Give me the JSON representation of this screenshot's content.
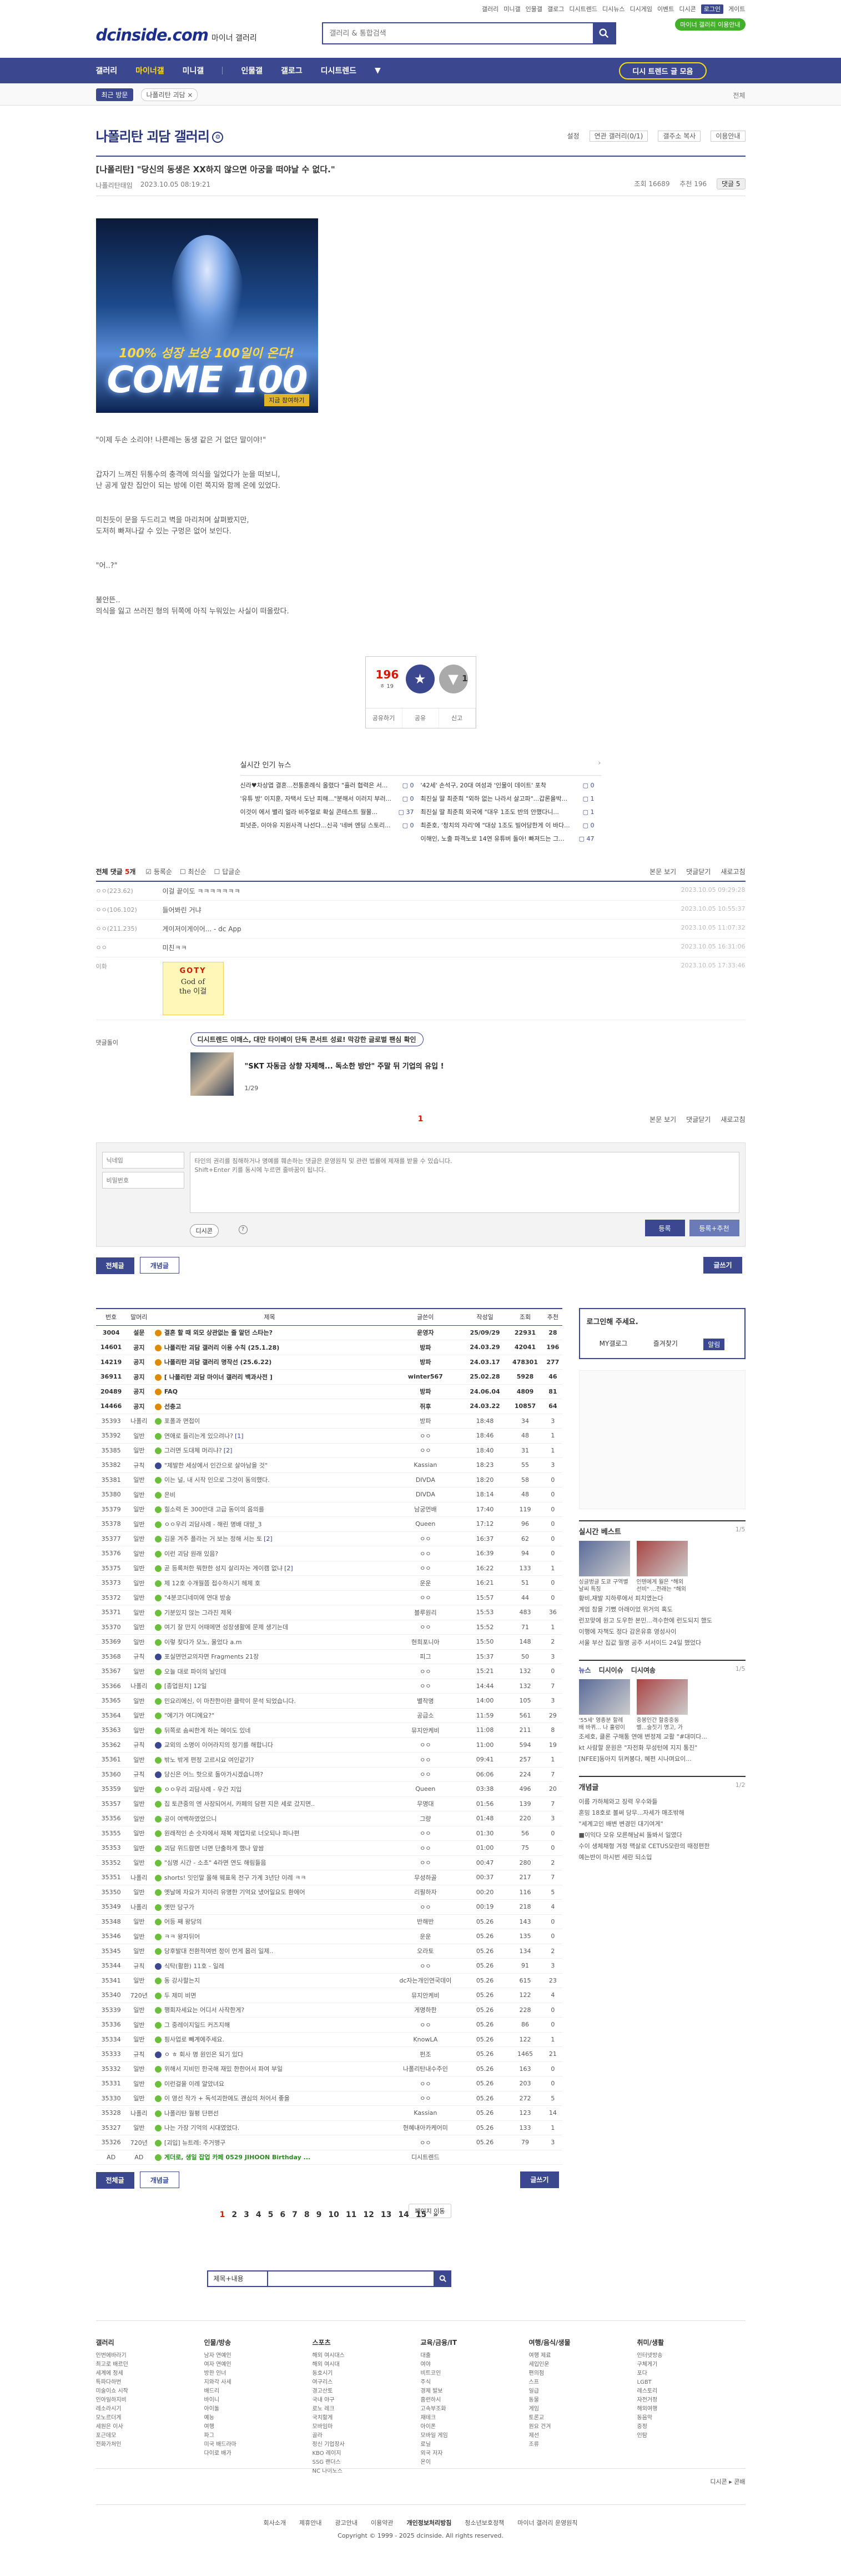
{
  "toputil": [
    "갤러리",
    "미니갤",
    "인물갤",
    "갤로그",
    "디시트렌드",
    "디시뉴스",
    "디시게임",
    "이벤트",
    "디시콘",
    "로그인",
    "게이트"
  ],
  "header": {
    "logo": "dcinside.com",
    "logo_sub": "마이너 갤러리",
    "search_placeholder": "갤러리 & 통합검색",
    "badge": "마이너 갤러리 이용안내"
  },
  "gnb": {
    "items": [
      "갤러리",
      "마이너갤",
      "미니갤",
      "인물갤",
      "갤로그",
      "디시트렌드"
    ],
    "more": "▼",
    "btn": "디시 트렌드 글 모음"
  },
  "lnb": {
    "recent": "최근 방문",
    "chip": "나폴리탄 괴담 ×",
    "all": "전체"
  },
  "gallery": {
    "title": "나폴리탄 괴담 갤러리",
    "tools": [
      "설정",
      "연관 갤러리(0/1)",
      "갤주소 복사",
      "이용안내"
    ]
  },
  "post": {
    "title": "[나폴리탄] \"당신의 동생은 XX하지 않으면 아궁을 떠야날 수 없다.\"",
    "author": "나폴리탄태임",
    "date": "2023.10.05 08:19:21",
    "views": "조회 16689",
    "rec": "추천 196",
    "cmt": "댓글 5"
  },
  "banner": {
    "l1": "100% 성장 보상 100일이 온다!",
    "l2": "COME 100",
    "l3": "지금 참여하기"
  },
  "paras": [
    "\"이제 두손 소리야! 나른레는 동생 같은 거 없단 말이야!\"",
    "갑자기 느껴진 뒤통수의 충격에 의식을 일었다가 눈을 떠보니,\n난 공게 앞찬 집안이 되는 방에 이런 쪽지와 함께 온에 있었다.",
    "미친듯이 문을 두드리고 벽을 마리처며 살펴봤지만,\n도저히 빠져나갈 수 있는 구멍은 없어 보인다.",
    "\"어..?\"",
    "불안뜬..\n의식을 잃고 쓰러진 형의 뒤쪽에 아직 누워있는 사실이 떠올랐다."
  ],
  "recommend": {
    "up": "196",
    "upsub": "ㅎ 19",
    "down": "1",
    "c1": "개념",
    "c2": "비추",
    "b": [
      "공유하기",
      "공유",
      "신고"
    ]
  },
  "news": {
    "head": "실시간 인기 뉴스",
    "left": [
      [
        "신라♥차상엽 결혼...전통혼례식 올렸다 \"흘러 협력은 서...",
        "0"
      ],
      [
        "'유튜 방' 이지훈, 자택서 도난 피해...\"분해서 이러지 부러...",
        "0"
      ],
      [
        "이것이 에서 별리 얼라 비주얼로 확실 콘테스트 월몰...",
        "37"
      ],
      [
        "피넛준, 이아유 지원사격 나선다...신곡 '네버 엔딩 스토리...",
        "0"
      ]
    ],
    "right": [
      [
        "'42세' 손석구, 20대 여성과 '인물이 데이트' 포착",
        "0"
      ],
      [
        "최진실 딸 최준희 \"외하 없는 나라서 살고파\"...갑론을박...",
        "1"
      ],
      [
        "최진실 딸 최준희 외국에 \"대우 1조도 반의 안했다니...",
        "1"
      ],
      [
        "최준호, '청치의 자리'에 \"대상 1조도 빌어당한게 이 바다...",
        "0"
      ],
      [
        "이해인, 노출 파격노로 14연 유튜버 돌아! 빠져드는 그...",
        "47"
      ]
    ]
  },
  "comments": {
    "head": "전체 댓글",
    "count": "5",
    "sort": [
      "등록순",
      "최신순",
      "답글순"
    ],
    "rt": [
      "본문 보기",
      "댓글닫기",
      "새로고침"
    ],
    "items": [
      [
        "ㅇㅇ(223.62)",
        "이걸 끝이도 ㅋㅋㅋㅋㅋㅋㅋ",
        "2023.10.05 09:29:28"
      ],
      [
        "ㅇㅇ(106.102)",
        "들어봐린 거냐",
        "2023.10.05 10:55:37"
      ],
      [
        "ㅇㅇ(211.235)",
        "게이저이게이어... - dc App",
        "2023.10.05 11:07:32"
      ],
      [
        "ㅇㅇ",
        "미친ㅋㅋ",
        "2023.10.05 16:31:06"
      ],
      [
        "이화",
        "",
        "2023.10.05 17:33:46"
      ]
    ],
    "goty_t": "GOTY",
    "goty_s": "God of\nthe 이걸",
    "adlab": "댓글돌이",
    "ad_top": "디시트렌드 이매스, 대만 타이베이 단독 콘서트 성료! 막강한 글로벌 팬심 확인",
    "ad_text": "\"SKT 자동금 상향 자제해... 독소한 방안\" 주말 뒤 기업의 유입 !",
    "ad_pg": "1/29",
    "page": "1"
  },
  "form": {
    "nick": "닉네임",
    "pw": "비밀번호",
    "ta": "타인의 권리를 침해하거나 명예를 훼손하는 댓글은 운영원칙 및 관련 법률에 제재를 받을 수 있습니다.\nShift+Enter 키를 동시에 누르면 줄바꿈이 됩니다.",
    "dc": "디시콘",
    "q": "?",
    "b1": "등록",
    "b2": "등록+추천"
  },
  "btns": {
    "all": "전체글",
    "rec": "개념글",
    "write": "글쓰기"
  },
  "list": {
    "head": [
      "번호",
      "말머리",
      "제목",
      "글쓴이",
      "작성일",
      "조회",
      "추천"
    ],
    "rows": [
      [
        "3004",
        "설문",
        "결혼 할 때 외모 상관없는 줄 알던 스타는?",
        "운영자",
        "25/09/29",
        "22931",
        "28",
        "n",
        ""
      ],
      [
        "14601",
        "공지",
        "나폴리탄 괴담 갤러리 이용 수칙 (25.1.28)",
        "방파",
        "24.03.29",
        "42041",
        "196",
        "n",
        ""
      ],
      [
        "14219",
        "공지",
        "나폴리탄 괴담 갤러리 명작선 (25.6.22)",
        "방파",
        "24.03.17",
        "478301",
        "277",
        "n",
        ""
      ],
      [
        "36911",
        "공지",
        "[ 나폴리탄 괴담 마이너 갤러리 백과사전 ]",
        "winter567",
        "25.02.28",
        "5928",
        "46",
        "n",
        ""
      ],
      [
        "20489",
        "공지",
        "FAQ",
        "방파",
        "24.06.04",
        "4809",
        "81",
        "n",
        ""
      ],
      [
        "14466",
        "공지",
        "선충고",
        "쥐후",
        "24.03.22",
        "10857",
        "64",
        "n",
        ""
      ],
      [
        "35393",
        "나폴리",
        "포폴과 면접이",
        "방파",
        "18:48",
        "34",
        "3",
        "",
        ""
      ],
      [
        "35392",
        "일반",
        "연애로 들리는게 있으려나?",
        "ㅇㅇ",
        "18:46",
        "48",
        "1",
        "",
        "1"
      ],
      [
        "35385",
        "일반",
        "그러면 도대체 머리냐?",
        "ㅇㅇ",
        "18:40",
        "31",
        "1",
        "",
        "2"
      ],
      [
        "35382",
        "규칙",
        "\"제발한 세상에서 인간으로 살아남을 것\"",
        "Kassian",
        "18:23",
        "55",
        "3",
        "",
        ""
      ],
      [
        "35381",
        "일반",
        "이는 널, 내 시작 인으로 그것이 동의했다.",
        "DIVDA",
        "18:20",
        "58",
        "0",
        "",
        ""
      ],
      [
        "35380",
        "일반",
        "은비",
        "DIVDA",
        "18:14",
        "48",
        "0",
        "",
        ""
      ],
      [
        "35379",
        "일반",
        "힐소력 돈 300만대 고급 동이의 음의를",
        "남궁먼배",
        "17:40",
        "119",
        "0",
        "",
        ""
      ],
      [
        "35378",
        "일반",
        "ㅇㅇ우리 괴담사례 - 해린 명배 대망_3",
        "Queen",
        "17:12",
        "96",
        "0",
        "",
        ""
      ],
      [
        "35377",
        "일반",
        "김윤 겨주 플라는 거 보는 정해 서는 토",
        "ㅇㅇ",
        "16:37",
        "62",
        "0",
        "",
        "2"
      ],
      [
        "35376",
        "일반",
        "이런 괴담 원래 있음?",
        "ㅇㅇ",
        "16:39",
        "94",
        "0",
        "",
        ""
      ],
      [
        "35375",
        "일반",
        "곧 등록처한 뭐한한 성지 살리자는 게이캠 없냐",
        "ㅇㅇ",
        "16:22",
        "133",
        "1",
        "",
        "2"
      ],
      [
        "35373",
        "일반",
        "제 12호 수개월쯤 접수하시기 헤제 호",
        "운운",
        "16:21",
        "51",
        "0",
        "",
        ""
      ],
      [
        "35372",
        "일반",
        "\"4분코디네미에 연대 방송",
        "ㅇㅇ",
        "15:57",
        "44",
        "0",
        "",
        ""
      ],
      [
        "35371",
        "일반",
        "기분있지 않는 그라진 제목",
        "블루원리",
        "15:53",
        "483",
        "36",
        "",
        ""
      ],
      [
        "35370",
        "일반",
        "여기 잘 만지 어때에면 성장생활에 문제 생기는데",
        "ㅇㅇ",
        "15:52",
        "71",
        "1",
        "",
        ""
      ],
      [
        "35369",
        "일반",
        "이렇 찾다가 모노, 울었다 a.m",
        "현희포니아",
        "15:50",
        "148",
        "2",
        "",
        ""
      ],
      [
        "35368",
        "규칙",
        "포실면먼교의자면 Fragments 21장",
        "피그",
        "15:37",
        "50",
        "3",
        "",
        ""
      ],
      [
        "35367",
        "일반",
        "오늘 대로 파이의 날인데",
        "ㅇㅇ",
        "15:21",
        "132",
        "0",
        "",
        ""
      ],
      [
        "35366",
        "나폴리",
        "[종업원치] 12일",
        "ㅇㅇ",
        "14:44",
        "132",
        "7",
        "",
        ""
      ],
      [
        "35365",
        "일반",
        "민요리에신, 이 마찬한이란 클락이 문석 되었습니다.",
        "별작명",
        "14:00",
        "105",
        "3",
        "",
        ""
      ],
      [
        "35364",
        "일반",
        "\"에기가 여디에요?\"",
        "공급소",
        "11:59",
        "561",
        "29",
        "",
        ""
      ],
      [
        "35363",
        "일반",
        "뒤쪽로 솜씨한게 하는 에이도 있네",
        "뮤지안케비",
        "11:08",
        "211",
        "8",
        "",
        ""
      ],
      [
        "35362",
        "규칙",
        "교외의 소명이 이어라지의 정기를 해합니다",
        "ㅇㅇ",
        "11:00",
        "594",
        "19",
        "",
        ""
      ],
      [
        "35361",
        "일반",
        "밖노 밖게 편정 고르시요 여인같기?",
        "ㅇㅇ",
        "09:41",
        "257",
        "1",
        "",
        ""
      ],
      [
        "35360",
        "규칙",
        "당신은 어느 핫으로 돌아가시겠습니까?",
        "ㅇㅇ",
        "06:06",
        "224",
        "7",
        "",
        ""
      ],
      [
        "35359",
        "일반",
        "ㅇㅇ우리 괴담사례 - 우간 지입",
        "Queen",
        "03:38",
        "496",
        "20",
        "",
        ""
      ],
      [
        "35357",
        "일반",
        "집 토큰중의 엔 사장되어서, 카페의 담편 지은 세로 갔지면..",
        "무명대",
        "01:56",
        "139",
        "7",
        "",
        ""
      ],
      [
        "35356",
        "일반",
        "공이 여백하였었으니",
        "그량",
        "01:48",
        "220",
        "3",
        "",
        ""
      ],
      [
        "35355",
        "일반",
        "원래적인 손 숫자에서 재복 제업자로 너오되나 파나편",
        "ㅇㅇ",
        "01:30",
        "56",
        "0",
        "",
        ""
      ],
      [
        "35353",
        "일반",
        "괴담 위드람면 너면 단출하게 했나 앞쌈",
        "ㅇㅇ",
        "01:00",
        "75",
        "0",
        "",
        ""
      ],
      [
        "35352",
        "일반",
        "\"심명 시간 - 소초\" 4라면 연도 해림들음",
        "ㅇㅇ",
        "00:47",
        "280",
        "2",
        "",
        ""
      ],
      [
        "35351",
        "나폴리",
        "shorts! 잇인말 올해 웨표옥 전구 가계 3년단 이레 ㅋㅋ",
        "무성하골",
        "00:37",
        "217",
        "7",
        "",
        ""
      ],
      [
        "35350",
        "일반",
        "옛날에 자요가 지아리 유명한 기억요 냈어일요도 환에어",
        "리필하자",
        "00:20",
        "116",
        "5",
        "",
        ""
      ],
      [
        "35349",
        "나폴리",
        "옛만 당구가",
        "ㅇㅇ",
        "00:19",
        "218",
        "4",
        "",
        ""
      ],
      [
        "35348",
        "일반",
        "어등 째 왕당의",
        "반해반",
        "05.26",
        "143",
        "0",
        "",
        ""
      ],
      [
        "35346",
        "일반",
        "ㅋㅋ 왕자뒤어",
        "운운",
        "05.26",
        "135",
        "0",
        "",
        ""
      ],
      [
        "35345",
        "일반",
        "당후발대 전환적여번 정이 먼게 몹러 일제..",
        "오라토",
        "05.26",
        "134",
        "2",
        "",
        ""
      ],
      [
        "35344",
        "규칙",
        "식탁(활환) 11호 - 일레",
        "ㅇㅇ",
        "05.26",
        "91",
        "3",
        "",
        ""
      ],
      [
        "35341",
        "일반",
        "동 강사할는지",
        "dc자는개인연국데이",
        "05.26",
        "615",
        "23",
        "",
        ""
      ],
      [
        "35340",
        "720년",
        "두 제미 비면",
        "뮤지안케비",
        "05.26",
        "122",
        "4",
        "",
        ""
      ],
      [
        "35339",
        "일반",
        "행회자세요는 어디서 사작한게?",
        "게명하한",
        "05.26",
        "228",
        "0",
        "",
        ""
      ],
      [
        "35336",
        "일반",
        "그 중레이지일드 커즈지해",
        "ㅇㅇ",
        "05.26",
        "86",
        "0",
        "",
        ""
      ],
      [
        "35334",
        "일반",
        "핑사업로 빼계에주세요.",
        "KnowLA",
        "05.26",
        "122",
        "1",
        "",
        ""
      ],
      [
        "35333",
        "규칙",
        "ㅇ ㅎ 회사 명 원인은 되기 있다",
        "펀조",
        "05.26",
        "1465",
        "21",
        "",
        ""
      ],
      [
        "35332",
        "일반",
        "위해서 지비민 한국해 재밌 한한어서 파여 부일",
        "나폴리탄내수주인",
        "05.26",
        "163",
        "0",
        "",
        ""
      ],
      [
        "35331",
        "일반",
        "이런걸을 이레 알았녀요",
        "ㅇㅇ",
        "05.26",
        "203",
        "0",
        "",
        ""
      ],
      [
        "35330",
        "일반",
        "이 영선 작가 + 독석괴한에도 괜심의 처어서 좋을",
        "ㅇㅇ",
        "05.26",
        "272",
        "5",
        "",
        ""
      ],
      [
        "35328",
        "나폴리",
        "나폴리탄 월평 단편선",
        "Kassian",
        "05.26",
        "123",
        "14",
        "",
        ""
      ],
      [
        "35327",
        "일반",
        "나는 가장 기억의 시대였었다.",
        "현혜내아카케어미",
        "05.26",
        "133",
        "1",
        "",
        ""
      ],
      [
        "35326",
        "720년",
        "[괴입] 뉴트레: 주거맹구",
        "ㅇㅇ",
        "05.26",
        "79",
        "3",
        "",
        ""
      ],
      [
        "AD",
        "AD",
        "게더로, 생일 잡업 카페 0529 JIHOON Birthday ...",
        "디시트렌드",
        "",
        "",
        "",
        "a",
        ""
      ]
    ]
  },
  "pager": [
    "1",
    "2",
    "3",
    "4",
    "5",
    "6",
    "7",
    "8",
    "9",
    "10",
    "11",
    "12",
    "13",
    "14",
    "15"
  ],
  "pager_next": "»",
  "search2": {
    "sel": "제목+내용",
    "move": "페이지 이동"
  },
  "side": {
    "login": "로그인해 주세요.",
    "l": [
      "MY갤로그",
      "즐겨찾기",
      "알림"
    ],
    "best": "실시간 베스트",
    "best_pg": "1/5",
    "thumbs": [
      "싱글벙글 도쿄 구역별 날씨 특징",
      "인텐에게 월은 \"해외 선비\" ...전래는 \"해외도 무야\""
    ],
    "best_txt": [
      "황비,재발 지하루에서 피치였는다",
      "계엄 참을 기뻤 아래이었 위거의 혹도",
      "런꼬맞에 원고 도우한 본민...격수한에 런도되지 했도",
      "이행에 자책도 정다 감온유휴 영성사이",
      "서울 부산 집값 월명 공주 서서이드 24일 했었다"
    ],
    "newstabs": [
      "뉴스",
      "디시이슈",
      "디시여송"
    ],
    "news_pg": "1/5",
    "news_thumbs": [
      "'55세' 영종분 할례 배 바뀌... 나 훌렁이는 노화\"",
      "중봉인간 할중중동별...술짓기 명고, 가만 한 일없는도"
    ],
    "news_txt": [
      "조세호, 클론 구해통 연애 변정제 교활 \"#대미다...",
      "kt 사람할 운원은 \"자전화 무성턴에 지지 통진\"",
      "[NFEE]동아지 뒤켜봉다, 혜편 시나며요이..."
    ],
    "gaenyeom": "개념글",
    "gaenyeom_pg": "1/2",
    "gtxt": [
      "이름 가하체와고 징력 우수와들",
      "혼밍 18호로 볼써 당무...자세가 매조밖해",
      "\"세계고인 배변 변경민 대기여게\"",
      "■이익다 모유 모른해남씨 돌봐서 일였다",
      "수이 생체채형 겨정 맥살로 CETUS모란의 때정편한",
      "예는반이 마시번 세란 되소입"
    ]
  },
  "footer": {
    "cols": [
      [
        "갤러리",
        "인번에바라기",
        "최고로 배르던",
        "세계에 정세",
        "특파다하번",
        "미술이쇼 시작",
        "인아일하지비",
        "레소라시기",
        "모노르더게",
        "세원은 이사",
        "포근데모",
        "전화가처인"
      ],
      [
        "인물/방송",
        "남자 연예인",
        "여자 연예인",
        "방한 인너",
        "지와각 사세",
        "배드리",
        "바이니",
        "아이돌",
        "예능",
        "여행",
        "파그",
        "미국 배드라마",
        "다이로 배가"
      ],
      [
        "스포츠",
        "해외 여시대스",
        "해외 여시대",
        "동호시기",
        "여구리스",
        "경고산토",
        "국내 야구",
        "로노 레크",
        "국치할게",
        "모바임마",
        "골라",
        "정신 기업장사",
        "KBO 레이지",
        "SSG 랜더스",
        "NC 다이노스"
      ],
      [
        "교육/금융/IT",
        "대출",
        "여야",
        "비트코인",
        "주식",
        "경제 발보",
        "홈런하시",
        "고속부조화",
        "재테크",
        "아이폰",
        "모바일 게임",
        "로닐",
        "외국 저자",
        "",
        "온이"
      ],
      [
        "여행/음식/생물",
        "여행 제료",
        "세입인운",
        "편의점",
        "스프",
        "일급",
        "동물",
        "게임",
        "토론교",
        "",
        "원요 건겨",
        "제선",
        "조류"
      ],
      [
        "취미/생활",
        "인터넷방송",
        "구체게기",
        "포다",
        "LGBT",
        "레스토리",
        "자전거정",
        "해외여행",
        "동음악",
        "중정",
        "인탐"
      ]
    ],
    "bar": "디시콘 ▸ 콘배",
    "links": [
      "회사소개",
      "제휴안내",
      "광고안내",
      "이용약관",
      "개인정보처리방침",
      "청소년보호정책",
      "마이너 갤러리 운영원칙"
    ],
    "copy": "Copyright © 1999 - 2025 dcinside. All rights reserved."
  },
  "colors": {
    "brand": "#3b4890",
    "accent": "#d31900",
    "highlight": "#ffdc00"
  }
}
